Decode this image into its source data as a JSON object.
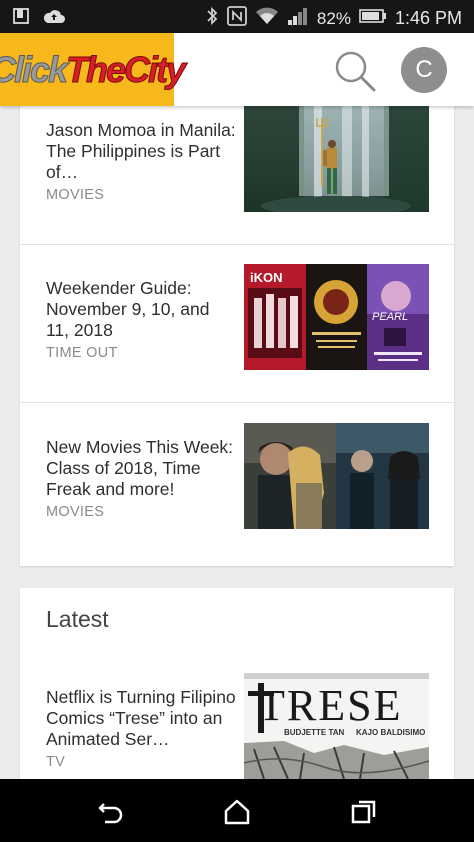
{
  "status_bar": {
    "battery": "82%",
    "time": "1:46 PM",
    "icons": [
      "sim-icon",
      "cloud-upload-icon",
      "bluetooth-icon",
      "nfc-icon",
      "wifi-icon",
      "signal-icon",
      "battery-icon"
    ]
  },
  "header": {
    "logo_parts": [
      "Click",
      "The",
      "City"
    ],
    "avatar_initial": "C",
    "brand_color": "#f6b81a",
    "icons": [
      "search-icon"
    ]
  },
  "featured": {
    "items": [
      {
        "title": "Jason Momoa in Manila: The Philippines is Part of…",
        "category": "MOVIES",
        "image": "aquaman-waterfall-thumbnail"
      },
      {
        "title": "Weekender Guide: November 9, 10, and 11, 2018",
        "category": "TIME OUT",
        "image": "weekender-posters-thumbnail"
      },
      {
        "title": "New Movies This Week: Class of 2018, Time Freak and more!",
        "category": "MOVIES",
        "image": "new-movies-thumbnail"
      }
    ]
  },
  "latest": {
    "heading": "Latest",
    "items": [
      {
        "title": "Netflix is Turning Filipino Comics “Trese” into an Animated Ser…",
        "category": "TV",
        "image": "trese-comics-thumbnail",
        "image_text": "TRESE",
        "image_credits": [
          "BUDJETTE TAN",
          "KAJO BALDISIMO"
        ]
      }
    ]
  },
  "poster_text": {
    "ikon": "iKON",
    "pearl": "PEARL"
  },
  "nav_bar": {
    "icons": [
      "back-icon",
      "home-icon",
      "recents-icon"
    ]
  }
}
